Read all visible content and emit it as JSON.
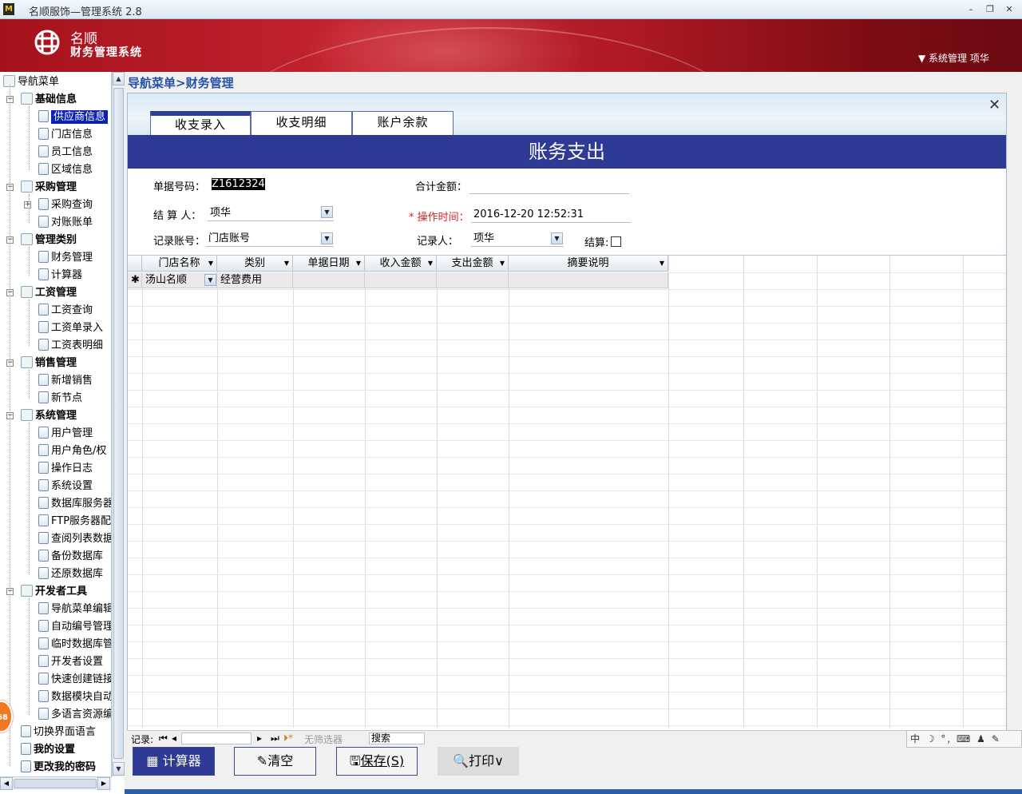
{
  "app": {
    "title": "名顺服饰—管理系统 2.8",
    "icon_label": "M",
    "min_glyph": "–",
    "restore_glyph": "❐",
    "close_glyph": "✕"
  },
  "banner": {
    "logo_line1": "名顺",
    "logo_line2": "财务管理系统",
    "user_label": "▼ 系统管理 项华"
  },
  "sidebar": {
    "root": "导航菜单",
    "groups": [
      {
        "label": "基础信息",
        "items": [
          "供应商信息",
          "门店信息",
          "员工信息",
          "区域信息"
        ]
      },
      {
        "label": "采购管理",
        "items": [
          "采购查询",
          "对账账单"
        ]
      },
      {
        "label": "管理类别",
        "items": [
          "财务管理",
          "计算器"
        ]
      },
      {
        "label": "工资管理",
        "items": [
          "工资查询",
          "工资单录入",
          "工资表明细"
        ]
      },
      {
        "label": "销售管理",
        "items": [
          "新增销售",
          "新节点"
        ]
      },
      {
        "label": "系统管理",
        "items": [
          "用户管理",
          "用户角色/权",
          "操作日志",
          "系统设置",
          "数据库服务器",
          "FTP服务器配",
          "查阅列表数据",
          "备份数据库",
          "还原数据库"
        ]
      },
      {
        "label": "开发者工具",
        "items": [
          "导航菜单编辑",
          "自动编号管理",
          "临时数据库管",
          "开发者设置",
          "快速创建链接",
          "数据模块自动",
          "多语言资源编"
        ]
      }
    ],
    "extra": [
      "切换界面语言",
      "我的设置",
      "更改我的密码"
    ],
    "badge": "68"
  },
  "breadcrumb": "导航菜单>财务管理",
  "tabs": [
    "收支录入",
    "收支明细",
    "账户余款"
  ],
  "close_glyph": "✕",
  "form": {
    "title": "账务支出",
    "doc_no_label": "单据号码：",
    "doc_no": "Z1612324",
    "total_label": "合计金额：",
    "total": "",
    "settler_label": "结 算 人：",
    "settler": "项华",
    "optime_label": "* 操作时间：",
    "optime": "2016-12-20 12:52:31",
    "account_label": "记录账号：",
    "account": "门店账号",
    "recorder_label": "记录人：",
    "recorder": "项华",
    "settled_label": "结算:",
    "settled": false
  },
  "grid": {
    "columns": [
      "门店名称",
      "类别",
      "单据日期",
      "收入金额",
      "支出金额",
      "摘要说明"
    ],
    "new_row_marker": "✱",
    "rows": [
      [
        "汤山名顺",
        "经营费用",
        "",
        "",
        "",
        ""
      ]
    ]
  },
  "navbar": {
    "record_label": "记录:",
    "first": "⏮",
    "prev": "◂",
    "next": "▸",
    "last": "⏭",
    "new": "⏵*",
    "filter_label": "无筛选器",
    "search_label": "搜索"
  },
  "ime": "中 ☽ °, ⌨ ♟ ✎",
  "buttons": {
    "calc": "计算器",
    "clear": "清空",
    "save": "保存(S)",
    "print": "打印∨"
  }
}
